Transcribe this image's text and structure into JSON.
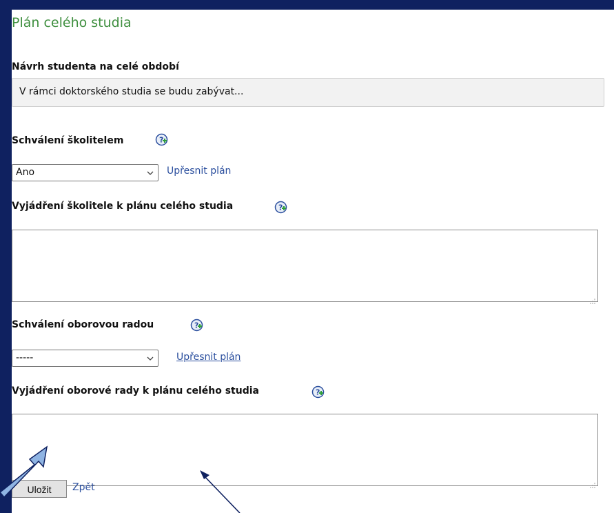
{
  "page": {
    "title": "Plán celého studia",
    "student_proposal": {
      "label": "Návrh studenta na celé období",
      "value": "V rámci doktorského studia se budu zabývat..."
    },
    "supervisor_approval": {
      "label": "Schválení školitelem",
      "help_icon": "help-plus-icon",
      "selected": "Ano",
      "link": "Upřesnit plán"
    },
    "supervisor_comment": {
      "label": "Vyjádření školitele k plánu celého studia",
      "help_icon": "help-plus-icon",
      "value": ""
    },
    "board_approval": {
      "label": "Schválení oborovou radou",
      "help_icon": "help-plus-icon",
      "selected": "-----",
      "link": "Upřesnit plán"
    },
    "board_comment": {
      "label": "Vyjádření oborové rady k plánu celého studia",
      "help_icon": "help-plus-icon",
      "value": ""
    },
    "actions": {
      "save_label": "Uložit",
      "back_label": "Zpět"
    }
  },
  "colors": {
    "frame": "#0f2160",
    "title": "#3f8f3f",
    "link": "#2b4f9e",
    "annotation_arrow_fill": "#8fb4e3",
    "annotation_arrow_stroke": "#0f2160"
  }
}
